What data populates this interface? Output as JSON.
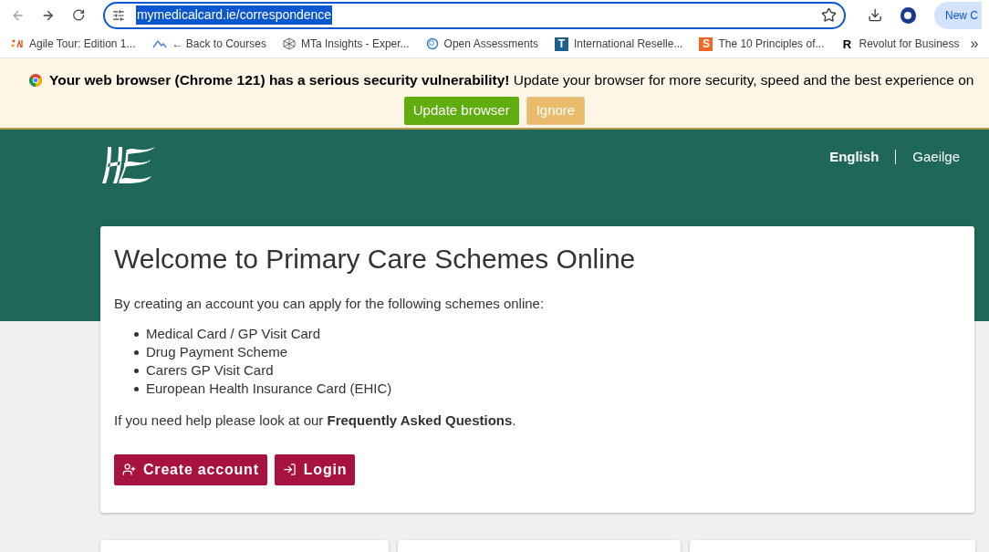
{
  "browser": {
    "url": "mymedicalcard.ie/correspondence",
    "url_selected": true,
    "side_button": "New C",
    "bookmarks": [
      {
        "label": "Agile Tour: Edition 1...",
        "kind": "dots"
      },
      {
        "label": "← Back to Courses",
        "kind": "mountain"
      },
      {
        "label": "MTa Insights - Exper...",
        "kind": "cube"
      },
      {
        "label": "Open Assessments",
        "kind": "swirl"
      },
      {
        "label": "International Reselle...",
        "kind": "letter",
        "badge": "T",
        "color": "#1f5f8b"
      },
      {
        "label": "The 10 Principles of...",
        "kind": "letter",
        "badge": "S",
        "color": "#f26522"
      },
      {
        "label": "Revolut for Business",
        "kind": "plain",
        "badge": "R"
      }
    ],
    "more": "»"
  },
  "banner": {
    "message": "**Your web browser (Chrome 121) has a serious security vulnerability!** Update your browser for more security, speed and the best experience on",
    "buttons": [
      {
        "label": "Update browser",
        "kind": "primary"
      },
      {
        "label": "Ignore",
        "kind": "secondary"
      }
    ]
  },
  "header": {
    "languages": [
      {
        "label": "English",
        "selected": true
      },
      {
        "label": "Gaeilge",
        "selected": false
      }
    ]
  },
  "card": {
    "title": "Welcome to Primary Care Schemes Online",
    "intro": "By creating an account you can apply for the following schemes online:",
    "schemes": [
      "Medical Card / GP Visit Card",
      "Drug Payment Scheme",
      "Carers GP Visit Card",
      "European Health Insurance Card (EHIC)"
    ],
    "help": "If you need help please look at our **Frequently Asked Questions**.",
    "buttons": [
      {
        "label": "Create account",
        "kind": "register"
      },
      {
        "label": "Login",
        "kind": "login"
      }
    ]
  }
}
